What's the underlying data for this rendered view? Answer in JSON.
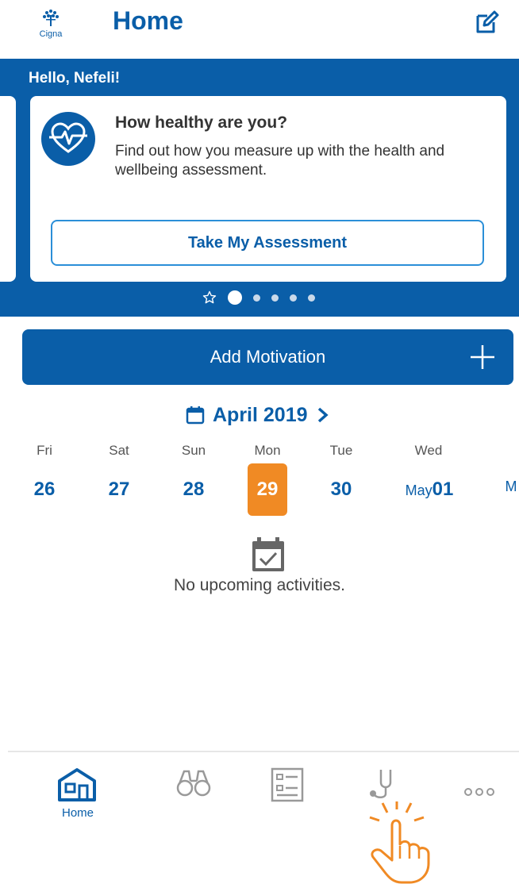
{
  "header": {
    "logo_text": "Cigna",
    "title": "Home"
  },
  "banner": {
    "greeting": "Hello, Nefeli!",
    "card": {
      "title": "How healthy are you?",
      "description": "Find out how you measure up with the health and wellbeing assessment.",
      "button_label": "Take My Assessment"
    },
    "pager": {
      "count": 5,
      "active_index": 0
    }
  },
  "motivation": {
    "label": "Add Motivation"
  },
  "calendar": {
    "month_label": "April 2019",
    "days": [
      {
        "name": "Fri",
        "num": "26"
      },
      {
        "name": "Sat",
        "num": "27"
      },
      {
        "name": "Sun",
        "num": "28"
      },
      {
        "name": "Mon",
        "num": "29"
      },
      {
        "name": "Tue",
        "num": "30"
      },
      {
        "name": "Wed",
        "prefix": "May",
        "num": "01"
      },
      {
        "name": "",
        "num": "M"
      }
    ],
    "selected": "29",
    "empty_message": "No upcoming activities."
  },
  "bottom_nav": {
    "items": [
      {
        "label": "Home",
        "icon": "home-icon",
        "active": true
      },
      {
        "label": "",
        "icon": "binoculars-icon"
      },
      {
        "label": "",
        "icon": "list-icon"
      },
      {
        "label": "",
        "icon": "stethoscope-icon"
      },
      {
        "label": "",
        "icon": "more-icon"
      }
    ]
  },
  "colors": {
    "primary": "#0a5ea8",
    "accent": "#f08a24",
    "outline": "#2b8fd8"
  }
}
